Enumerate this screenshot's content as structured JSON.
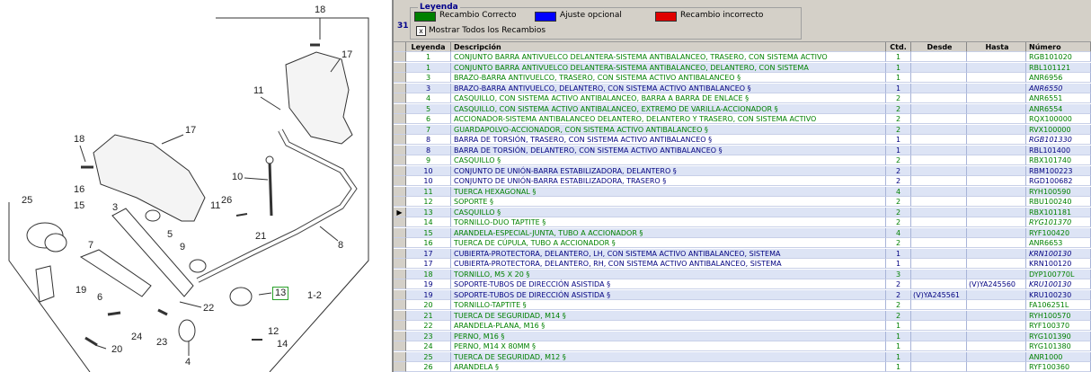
{
  "diagram": {
    "callouts": [
      "18",
      "17",
      "11",
      "17",
      "18",
      "10",
      "16",
      "15",
      "3",
      "25",
      "26",
      "11",
      "5",
      "21",
      "7",
      "9",
      "8",
      "19",
      "6",
      "22",
      "13",
      "1-2",
      "24",
      "23",
      "20",
      "12",
      "14",
      "4"
    ],
    "selected_callout": "13"
  },
  "legend": {
    "number": "31",
    "title": "Leyenda",
    "items": [
      {
        "label": "Recambio Correcto",
        "color": "#008000"
      },
      {
        "label": "Ajuste opcional",
        "color": "#0000ff"
      },
      {
        "label": "Recambio incorrecto",
        "color": "#e00000"
      }
    ],
    "show_all_checked": "x",
    "show_all_label": "Mostrar Todos los Recambios"
  },
  "table": {
    "headers": {
      "leyenda": "Leyenda",
      "descripcion": "Descripción",
      "cantidad": "Ctd.",
      "desde": "Desde",
      "hasta": "Hasta",
      "numero": "Número"
    },
    "selected_marker": "▶",
    "rows": [
      {
        "leyenda": "1",
        "descripcion": "CONJUNTO BARRA ANTIVUELCO DELANTERA-SISTEMA ANTIBALANCEO, TRASERO, CON SISTEMA ACTIVO",
        "cantidad": "1",
        "desde": "",
        "hasta": "",
        "numero": "RGB101020",
        "color": "green"
      },
      {
        "leyenda": "1",
        "descripcion": "CONJUNTO BARRA ANTIVUELCO DELANTERA-SISTEMA ANTIBALANCEO, DELANTERO, CON SISTEMA",
        "cantidad": "1",
        "desde": "",
        "hasta": "",
        "numero": "RBL101121",
        "color": "green"
      },
      {
        "leyenda": "3",
        "descripcion": "BRAZO-BARRA ANTIVUELCO, TRASERO, CON SISTEMA ACTIVO ANTIBALANCEO §",
        "cantidad": "1",
        "desde": "",
        "hasta": "",
        "numero": "ANR6956",
        "color": "green"
      },
      {
        "leyenda": "3",
        "descripcion": "BRAZO-BARRA ANTIVUELCO, DELANTERO, CON SISTEMA ACTIVO ANTIBALANCEO §",
        "cantidad": "1",
        "desde": "",
        "hasta": "",
        "numero": "ANR6550",
        "color": "navy",
        "italic": "yes"
      },
      {
        "leyenda": "4",
        "descripcion": "CASQUILLO, CON SISTEMA ACTIVO ANTIBALANCEO, BARRA A BARRA DE ENLACE §",
        "cantidad": "2",
        "desde": "",
        "hasta": "",
        "numero": "ANR6551",
        "color": "green"
      },
      {
        "leyenda": "5",
        "descripcion": "CASQUILLO, CON SISTEMA ACTIVO ANTIBALANCEO, EXTREMO DE VARILLA-ACCIONADOR §",
        "cantidad": "2",
        "desde": "",
        "hasta": "",
        "numero": "ANR6554",
        "color": "green"
      },
      {
        "leyenda": "6",
        "descripcion": "ACCIONADOR-SISTEMA ANTIBALANCEO DELANTERO, DELANTERO Y TRASERO, CON SISTEMA ACTIVO",
        "cantidad": "2",
        "desde": "",
        "hasta": "",
        "numero": "RQX100000",
        "color": "green"
      },
      {
        "leyenda": "7",
        "descripcion": "GUARDAPOLVO-ACCIONADOR, CON SISTEMA ACTIVO ANTIBALANCEO §",
        "cantidad": "2",
        "desde": "",
        "hasta": "",
        "numero": "RVX100000",
        "color": "green"
      },
      {
        "leyenda": "8",
        "descripcion": "BARRA DE TORSIÓN, TRASERO, CON SISTEMA ACTIVO ANTIBALANCEO §",
        "cantidad": "1",
        "desde": "",
        "hasta": "",
        "numero": "RGB101330",
        "color": "navy",
        "italic": "yes"
      },
      {
        "leyenda": "8",
        "descripcion": "BARRA DE TORSIÓN, DELANTERO, CON SISTEMA ACTIVO ANTIBALANCEO §",
        "cantidad": "1",
        "desde": "",
        "hasta": "",
        "numero": "RBL101400",
        "color": "navy"
      },
      {
        "leyenda": "9",
        "descripcion": "CASQUILLO §",
        "cantidad": "2",
        "desde": "",
        "hasta": "",
        "numero": "RBX101740",
        "color": "green"
      },
      {
        "leyenda": "10",
        "descripcion": "CONJUNTO DE UNIÓN-BARRA ESTABILIZADORA, DELANTERO §",
        "cantidad": "2",
        "desde": "",
        "hasta": "",
        "numero": "RBM100223",
        "color": "navy"
      },
      {
        "leyenda": "10",
        "descripcion": "CONJUNTO DE UNIÓN-BARRA ESTABILIZADORA, TRASERO §",
        "cantidad": "2",
        "desde": "",
        "hasta": "",
        "numero": "RGD100682",
        "color": "navy"
      },
      {
        "leyenda": "11",
        "descripcion": "TUERCA HEXAGONAL §",
        "cantidad": "4",
        "desde": "",
        "hasta": "",
        "numero": "RYH100590",
        "color": "green"
      },
      {
        "leyenda": "12",
        "descripcion": "SOPORTE §",
        "cantidad": "2",
        "desde": "",
        "hasta": "",
        "numero": "RBU100240",
        "color": "green"
      },
      {
        "leyenda": "13",
        "descripcion": "CASQUILLO §",
        "cantidad": "2",
        "desde": "",
        "hasta": "",
        "numero": "RBX101181",
        "color": "green",
        "selected": "yes"
      },
      {
        "leyenda": "14",
        "descripcion": "TORNILLO-DUO TAPTITE §",
        "cantidad": "2",
        "desde": "",
        "hasta": "",
        "numero": "RYG101370",
        "color": "green",
        "italic": "yes"
      },
      {
        "leyenda": "15",
        "descripcion": "ARANDELA-ESPECIAL-JUNTA, TUBO A ACCIONADOR §",
        "cantidad": "4",
        "desde": "",
        "hasta": "",
        "numero": "RYF100420",
        "color": "green"
      },
      {
        "leyenda": "16",
        "descripcion": "TUERCA DE CÚPULA, TUBO A ACCIONADOR §",
        "cantidad": "2",
        "desde": "",
        "hasta": "",
        "numero": "ANR6653",
        "color": "green"
      },
      {
        "leyenda": "17",
        "descripcion": "CUBIERTA-PROTECTORA, DELANTERO, LH, CON SISTEMA ACTIVO ANTIBALANCEO, SISTEMA",
        "cantidad": "1",
        "desde": "",
        "hasta": "",
        "numero": "KRN100130",
        "color": "navy",
        "italic": "yes"
      },
      {
        "leyenda": "17",
        "descripcion": "CUBIERTA-PROTECTORA, DELANTERO, RH, CON SISTEMA ACTIVO ANTIBALANCEO, SISTEMA",
        "cantidad": "1",
        "desde": "",
        "hasta": "",
        "numero": "KRN100120",
        "color": "navy"
      },
      {
        "leyenda": "18",
        "descripcion": "TORNILLO, M5 X 20 §",
        "cantidad": "3",
        "desde": "",
        "hasta": "",
        "numero": "DYP100770L",
        "color": "green"
      },
      {
        "leyenda": "19",
        "descripcion": "SOPORTE-TUBOS DE DIRECCIÓN ASISTIDA §",
        "cantidad": "2",
        "desde": "",
        "hasta": "(V)YA245560",
        "numero": "KRU100130",
        "color": "navy",
        "italic": "yes"
      },
      {
        "leyenda": "19",
        "descripcion": "SOPORTE-TUBOS DE DIRECCIÓN ASISTIDA §",
        "cantidad": "2",
        "desde": "(V)YA245561",
        "hasta": "",
        "numero": "KRU100230",
        "color": "navy"
      },
      {
        "leyenda": "20",
        "descripcion": "TORNILLO-TAPTITE §",
        "cantidad": "2",
        "desde": "",
        "hasta": "",
        "numero": "FA106251L",
        "color": "green"
      },
      {
        "leyenda": "21",
        "descripcion": "TUERCA DE SEGURIDAD, M14 §",
        "cantidad": "2",
        "desde": "",
        "hasta": "",
        "numero": "RYH100570",
        "color": "green"
      },
      {
        "leyenda": "22",
        "descripcion": "ARANDELA-PLANA, M16 §",
        "cantidad": "1",
        "desde": "",
        "hasta": "",
        "numero": "RYF100370",
        "color": "green"
      },
      {
        "leyenda": "23",
        "descripcion": "PERNO, M16 §",
        "cantidad": "1",
        "desde": "",
        "hasta": "",
        "numero": "RYG101390",
        "color": "green"
      },
      {
        "leyenda": "24",
        "descripcion": "PERNO, M14 X 80MM §",
        "cantidad": "1",
        "desde": "",
        "hasta": "",
        "numero": "RYG101380",
        "color": "green"
      },
      {
        "leyenda": "25",
        "descripcion": "TUERCA DE SEGURIDAD, M12 §",
        "cantidad": "1",
        "desde": "",
        "hasta": "",
        "numero": "ANR1000",
        "color": "green"
      },
      {
        "leyenda": "26",
        "descripcion": "ARANDELA §",
        "cantidad": "1",
        "desde": "",
        "hasta": "",
        "numero": "RYF100360",
        "color": "green"
      }
    ]
  }
}
